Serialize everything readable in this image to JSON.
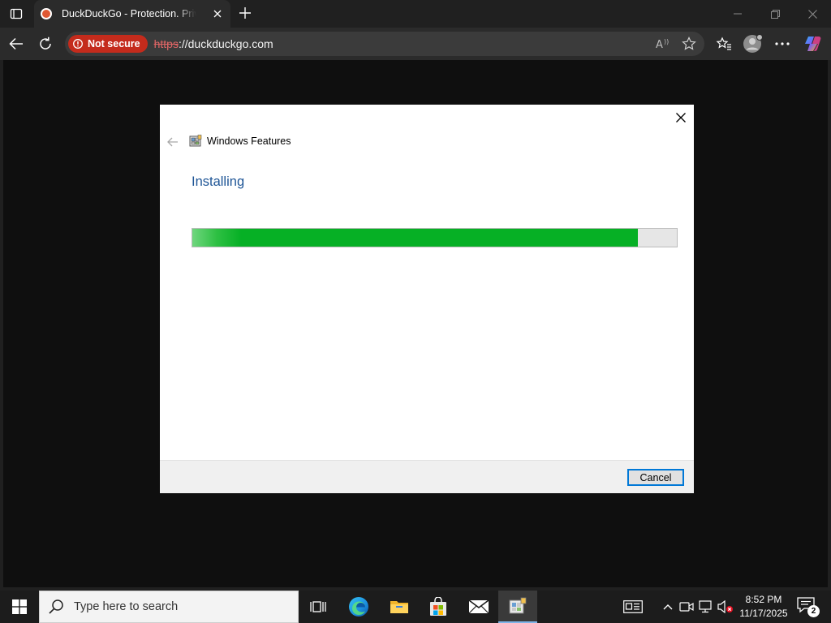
{
  "browser": {
    "tab": {
      "title": "DuckDuckGo - Protection. Privacy. Peace of mind."
    },
    "address": {
      "security_label": "Not secure",
      "url_scheme": "https",
      "url_rest": "://duckduckgo.com"
    }
  },
  "dialog": {
    "title": "Windows Features",
    "heading": "Installing",
    "progress": 0.92,
    "cancel_label": "Cancel"
  },
  "taskbar": {
    "search_placeholder": "Type here to search",
    "clock": {
      "time": "8:52 PM",
      "date": "11/17/2025"
    },
    "notification_count": "2"
  },
  "colors": {
    "not_secure": "#c42b1c",
    "progress_fill": "#06b025",
    "dialog_heading": "#1e5596",
    "focus_border": "#0078d7"
  }
}
